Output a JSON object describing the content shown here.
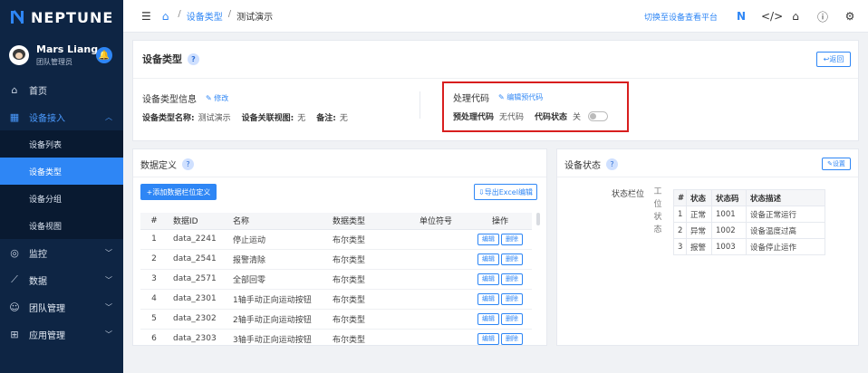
{
  "app": {
    "name": "NEPTUNE"
  },
  "user": {
    "name": "Mars Liang",
    "role": "团队管理员"
  },
  "sidebar": {
    "items": [
      {
        "label": "首页",
        "icon": "home-icon"
      },
      {
        "label": "设备接入",
        "icon": "grid-icon"
      },
      {
        "label": "监控",
        "icon": "monitor-icon"
      },
      {
        "label": "数据",
        "icon": "data-icon"
      },
      {
        "label": "团队管理",
        "icon": "team-icon"
      },
      {
        "label": "应用管理",
        "icon": "apps-icon"
      }
    ],
    "sub_items": [
      "设备列表",
      "设备类型",
      "设备分组",
      "设备视图"
    ]
  },
  "topbar": {
    "breadcrumb": [
      "设备类型",
      "测试演示"
    ],
    "switch_link": "切换至设备查看平台"
  },
  "top_card": {
    "title": "设备类型",
    "back_label": "返回",
    "info_title": "设备类型信息",
    "edit_label": "修改",
    "fields": [
      {
        "label": "设备类型名称:",
        "value": "测试演示"
      },
      {
        "label": "设备关联视图:",
        "value": "无"
      },
      {
        "label": "备注:",
        "value": "无"
      }
    ],
    "proc": {
      "title": "处理代码",
      "edit_label": "编辑预代码",
      "pre_label": "预处理代码",
      "pre_value": "无代码",
      "state_label": "代码状态",
      "state_value": "关"
    }
  },
  "data_card": {
    "title": "数据定义",
    "add_label": "+添加数据栏位定义",
    "export_label": "导出Excel编辑",
    "columns": [
      "#",
      "数据ID",
      "名称",
      "数据类型",
      "单位符号",
      "操作"
    ],
    "edit_label": "编辑",
    "delete_label": "删除",
    "rows": [
      {
        "n": "1",
        "id": "data_2241",
        "name": "停止运动",
        "type": "布尔类型",
        "unit": ""
      },
      {
        "n": "2",
        "id": "data_2541",
        "name": "报警清除",
        "type": "布尔类型",
        "unit": ""
      },
      {
        "n": "3",
        "id": "data_2571",
        "name": "全部回零",
        "type": "布尔类型",
        "unit": ""
      },
      {
        "n": "4",
        "id": "data_2301",
        "name": "1轴手动正向运动按钮",
        "type": "布尔类型",
        "unit": ""
      },
      {
        "n": "5",
        "id": "data_2302",
        "name": "2轴手动正向运动按钮",
        "type": "布尔类型",
        "unit": ""
      },
      {
        "n": "6",
        "id": "data_2303",
        "name": "3轴手动正向运动按钮",
        "type": "布尔类型",
        "unit": ""
      }
    ]
  },
  "status_card": {
    "title": "设备状态",
    "set_label": "设置",
    "field_label": "状态栏位",
    "field_value": [
      "工",
      "位",
      "状",
      "态"
    ],
    "columns": [
      "#",
      "状态",
      "状态码",
      "状态描述"
    ],
    "rows": [
      {
        "n": "1",
        "state": "正常",
        "code": "1001",
        "desc": "设备正常运行"
      },
      {
        "n": "2",
        "state": "异常",
        "code": "1002",
        "desc": "设备温度过高"
      },
      {
        "n": "3",
        "state": "报警",
        "code": "1003",
        "desc": "设备停止运作"
      }
    ]
  }
}
